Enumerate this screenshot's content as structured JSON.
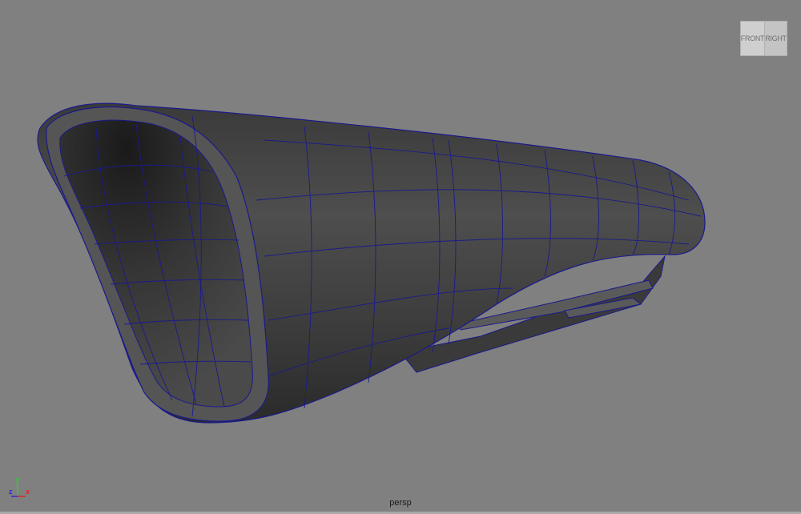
{
  "viewport": {
    "camera_name": "persp",
    "background_color": "#808080",
    "wireframe_color": "#1a1a8c"
  },
  "view_cube": {
    "front_label": "FRONT",
    "right_label": "RIGHT"
  },
  "axis_indicator": {
    "y_label": "y",
    "z_label": "z",
    "x_label": "x",
    "y_color": "#3ec43e",
    "z_color": "#2a2ad0",
    "x_color": "#d42a2a"
  }
}
